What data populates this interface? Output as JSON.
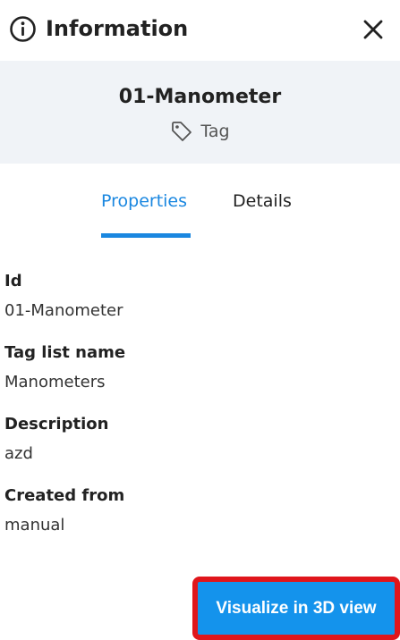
{
  "header": {
    "title": "Information",
    "info_icon": "info-circle-icon",
    "close_icon": "close-icon"
  },
  "summary": {
    "title": "01-Manometer",
    "type_icon": "tag-icon",
    "type_label": "Tag"
  },
  "tabs": [
    {
      "label": "Properties",
      "active": true
    },
    {
      "label": "Details",
      "active": false
    }
  ],
  "properties": [
    {
      "label": "Id",
      "value": "01-Manometer"
    },
    {
      "label": "Tag list name",
      "value": "Manometers"
    },
    {
      "label": "Description",
      "value": "azd"
    },
    {
      "label": "Created from",
      "value": "manual"
    }
  ],
  "action": {
    "label": "Visualize in 3D view"
  },
  "colors": {
    "accent": "#1a87e0",
    "summary_bg": "#f0f3f7",
    "button_bg": "#1493ec",
    "button_border": "#e0161b"
  }
}
